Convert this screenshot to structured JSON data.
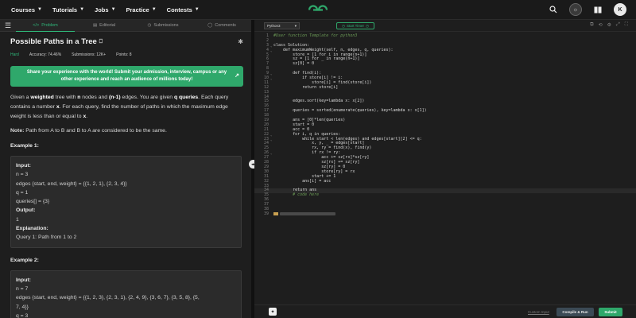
{
  "nav": {
    "links": [
      "Courses",
      "Tutorials",
      "Jobs",
      "Practice",
      "Contests"
    ],
    "logo": "GG",
    "avatar_letter": "K"
  },
  "tabs": [
    {
      "label": "Problem",
      "icon": "code-icon"
    },
    {
      "label": "Editorial",
      "icon": "book-icon"
    },
    {
      "label": "Submissions",
      "icon": "history-icon"
    },
    {
      "label": "Comments",
      "icon": "comment-icon"
    }
  ],
  "problem": {
    "title": "Possible Paths in a Tree",
    "difficulty": "Hard",
    "accuracy": "Accuracy: 74.46%",
    "submissions": "Submissions: 12K+",
    "points": "Points: 8",
    "banner": "Share your experience with the world! Submit your admission, interview, campus or any other experience and reach an audience of millions today!",
    "desc_parts": {
      "p1": "Given a ",
      "b1": "weighted",
      "p2": " tree with ",
      "b2": "n",
      "p3": " nodes and ",
      "b3": "(n-1)",
      "p4": " edges. You are given ",
      "b4": "q queries",
      "p5": ". Each query contains a number ",
      "b5": "x",
      "p6": ". For each query, find the number of paths in which the maximum edge weight is less than or equal to ",
      "b6": "x",
      "p7": "."
    },
    "note_label": "Note:",
    "note_text": " Path from A to B and B to A are considered to be the same.",
    "example1": {
      "heading": "Example 1:",
      "input_label": "Input:",
      "lines": [
        "n = 3",
        "edges {start, end, weight} = {{1, 2, 1}, {2, 3, 4}}",
        "q = 1",
        "queries[] = {3}"
      ],
      "output_label": "Output:",
      "output": "1",
      "expl_label": "Explanation:",
      "expl": "Query 1: Path from 1 to 2"
    },
    "example2": {
      "heading": "Example 2:",
      "input_label": "Input:",
      "lines": [
        "n = 7",
        "edges {start, end, weight} = {{1, 2, 3}, {2, 3, 1}, {2, 4, 9}, {3, 6, 7}, {3, 5, 8}, {5,",
        "7, 4}}",
        "q = 3"
      ]
    }
  },
  "editor": {
    "language": "Python3",
    "timer": "Start Timer",
    "custom_input": "Custom Input",
    "compile": "Compile & Run",
    "submit": "Submit",
    "code_lines": [
      {
        "n": "1",
        "t": "#User function Template for python3",
        "c": true
      },
      {
        "n": "2",
        "t": ""
      },
      {
        "n": "3",
        "t": "class Solution:"
      },
      {
        "n": "4",
        "t": "    def maximumWeight(self, n, edges, q, queries):"
      },
      {
        "n": "5",
        "t": "        store = [1 for i in range(n+1)]"
      },
      {
        "n": "6",
        "t": "        sz = [1 for _ in range(n+1)]"
      },
      {
        "n": "7",
        "t": "        sz[0] = 0"
      },
      {
        "n": "8",
        "t": ""
      },
      {
        "n": "9",
        "t": "        def find(i):"
      },
      {
        "n": "10",
        "t": "            if store[i] != i:"
      },
      {
        "n": "11",
        "t": "                store[i] = find(store[i])"
      },
      {
        "n": "12",
        "t": "            return store[i]"
      },
      {
        "n": "13",
        "t": ""
      },
      {
        "n": "14",
        "t": ""
      },
      {
        "n": "15",
        "t": "        edges.sort(key=lambda x: x[2])"
      },
      {
        "n": "16",
        "t": ""
      },
      {
        "n": "17",
        "t": "        queries = sorted(enumerate(queries), key=lambda x: x[1])"
      },
      {
        "n": "18",
        "t": ""
      },
      {
        "n": "19",
        "t": "        ans = [0]*len(queries)"
      },
      {
        "n": "20",
        "t": "        start = 0"
      },
      {
        "n": "21",
        "t": "        acc = 0"
      },
      {
        "n": "22",
        "t": "        for i, q in queries:"
      },
      {
        "n": "23",
        "t": "            while start < len(edges) and edges[start][2] <= q:"
      },
      {
        "n": "24",
        "t": "                x, y, _ = edges[start]"
      },
      {
        "n": "25",
        "t": "                rx, ry = find(x), find(y)"
      },
      {
        "n": "26",
        "t": "                if rx != ry:"
      },
      {
        "n": "27",
        "t": "                    acc += sz[rx]*sz[ry]"
      },
      {
        "n": "28",
        "t": "                    sz[rx] += sz[ry]"
      },
      {
        "n": "29",
        "t": "                    sz[ry] = 0"
      },
      {
        "n": "30",
        "t": "                    store[ry] = rx"
      },
      {
        "n": "31",
        "t": "                start += 1"
      },
      {
        "n": "32",
        "t": "            ans[i] = acc"
      },
      {
        "n": "33",
        "t": ""
      },
      {
        "n": "34",
        "t": "        return ans",
        "cur": true
      },
      {
        "n": "35",
        "t": "        # code here",
        "c": true
      },
      {
        "n": "36",
        "t": ""
      },
      {
        "n": "37",
        "t": ""
      },
      {
        "n": "38",
        "t": ""
      },
      {
        "n": "39",
        "t": "",
        "ghost": true
      }
    ]
  }
}
